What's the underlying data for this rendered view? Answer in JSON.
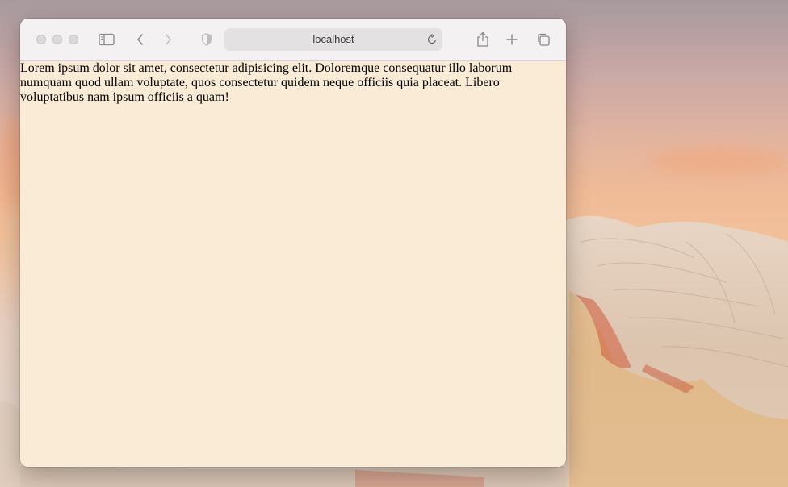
{
  "browser": {
    "address": "localhost"
  },
  "page": {
    "paragraph": "Lorem ipsum dolor sit amet, consectetur adipisicing elit. Doloremque consequatur illo laborum numquam quod ullam voluptate, quos consectetur quidem neque officiis quia placeat. Libero voluptatibus nam ipsum officiis a quam!",
    "background_color": "#faebd7"
  },
  "icons": {
    "traffic_lights": [
      "close-button",
      "minimize-button",
      "zoom-button"
    ],
    "toolbar": [
      "sidebar-icon",
      "back-icon",
      "forward-icon",
      "privacy-shield-icon",
      "reload-icon",
      "share-icon",
      "new-tab-icon",
      "tab-overview-icon"
    ]
  }
}
